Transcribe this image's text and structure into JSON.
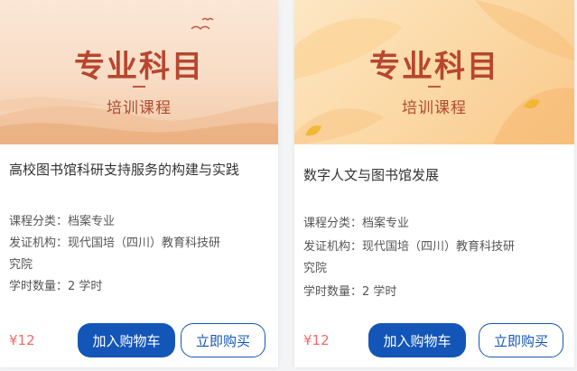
{
  "courses": [
    {
      "banner_title": "专业科目",
      "banner_subtitle": "培训课程",
      "title": "高校图书馆科研支持服务的构建与实践",
      "category": "课程分类：档案专业",
      "issuer_line1": "发证机构：现代国培（四川）教育科技研",
      "issuer_line2": "究院",
      "hours": "学时数量：2 学时",
      "price": "¥12",
      "add_to_cart_label": "加入购物车",
      "buy_now_label": "立即购买"
    },
    {
      "banner_title": "专业科目",
      "banner_subtitle": "培训课程",
      "title": "数字人文与图书馆发展",
      "category": "课程分类：档案专业",
      "issuer_line1": "发证机构：现代国培（四川）教育科技研",
      "issuer_line2": "究院",
      "hours": "学时数量：2 学时",
      "price": "¥12",
      "add_to_cart_label": "加入购物车",
      "buy_now_label": "立即购买"
    }
  ],
  "colors": {
    "accent_blue": "#1456b8",
    "price_red": "#f26b6b",
    "banner_title": "#b8462f"
  }
}
